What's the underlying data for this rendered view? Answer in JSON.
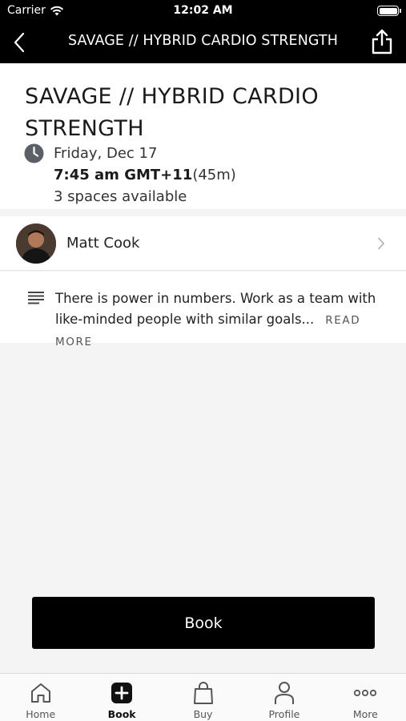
{
  "status_bar": {
    "carrier": "Carrier",
    "time": "12:02 AM"
  },
  "nav": {
    "title": "SAVAGE // HYBRID CARDIO STRENGTH",
    "back_icon": "chevron-left-icon",
    "share_icon": "share-icon"
  },
  "class_info": {
    "title": "SAVAGE // HYBRID CARDIO STRENGTH",
    "date": "Friday, Dec 17",
    "time": "7:45 am GMT+11",
    "duration": "(45m)",
    "spaces": "3 spaces available"
  },
  "coach": {
    "name": "Matt Cook"
  },
  "description": {
    "text": "There is power in numbers. Work as a team with like-minded people with similar goals...",
    "read_more": "READ MORE"
  },
  "book_button": {
    "label": "Book"
  },
  "tab_bar": {
    "items": [
      {
        "label": "Home",
        "icon": "home-icon"
      },
      {
        "label": "Book",
        "icon": "plus-square-icon"
      },
      {
        "label": "Buy",
        "icon": "shopping-bag-icon"
      },
      {
        "label": "Profile",
        "icon": "person-icon"
      },
      {
        "label": "More",
        "icon": "more-dots-icon"
      }
    ],
    "active": "Book"
  },
  "colors": {
    "header_bg": "#000000",
    "page_bg": "#f4f4f5",
    "card_bg": "#ffffff",
    "button_bg": "#000000"
  }
}
